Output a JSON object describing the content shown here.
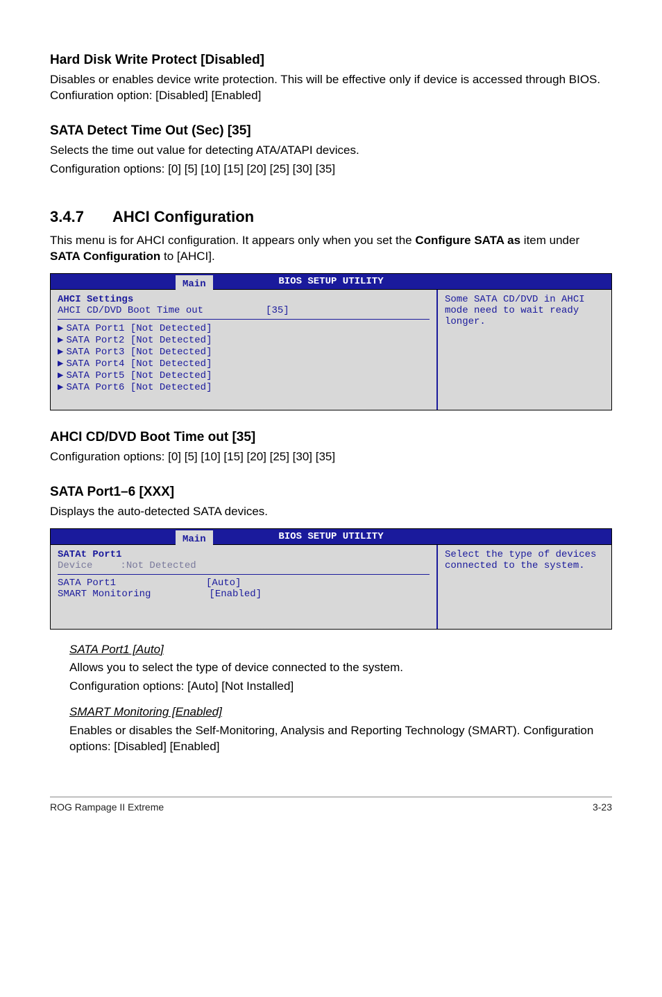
{
  "s1": {
    "title": "Hard Disk Write Protect [Disabled]",
    "p": "Disables or enables device write protection. This will be effective only if device is accessed through BIOS. Confiuration option: [Disabled] [Enabled]"
  },
  "s2": {
    "title": "SATA Detect Time Out (Sec) [35]",
    "p1": "Selects the time out value for detecting ATA/ATAPI devices.",
    "p2": "Configuration options: [0] [5] [10] [15] [20] [25] [30] [35]"
  },
  "sec": {
    "num": "3.4.7",
    "title": "AHCI Configuration"
  },
  "sec_p_a": "This menu is for AHCI configuration. It appears only when you set the ",
  "sec_p_b": "Configure SATA as",
  "sec_p_c": " item under ",
  "sec_p_d": "SATA Configuration",
  "sec_p_e": " to [AHCI].",
  "bios1": {
    "title": "BIOS SETUP UTILITY",
    "tab": "Main",
    "heading": "AHCI Settings",
    "row_label": "AHCI CD/DVD Boot Time out",
    "row_value": "[35]",
    "ports": [
      "SATA Port1 [Not Detected]",
      "SATA Port2 [Not Detected]",
      "SATA Port3 [Not Detected]",
      "SATA Port4 [Not Detected]",
      "SATA Port5 [Not Detected]",
      "SATA Port6 [Not Detected]"
    ],
    "help": "Some SATA CD/DVD in AHCI mode need to wait ready longer."
  },
  "s3": {
    "title": "AHCI CD/DVD Boot Time out [35]",
    "p": "Configuration options: [0] [5] [10] [15] [20] [25] [30] [35]"
  },
  "s4": {
    "title": "SATA Port1–6 [XXX]",
    "p": "Displays the auto-detected SATA devices."
  },
  "bios2": {
    "title": "BIOS SETUP UTILITY",
    "tab": "Main",
    "heading": "SATAt Port1",
    "device_lbl": "Device",
    "device_val": ":Not Detected",
    "r1_lbl": "SATA Port1",
    "r1_val": "[Auto]",
    "r2_lbl": "SMART Monitoring",
    "r2_val": "[Enabled]",
    "help": "Select the type of devices connected to the system."
  },
  "d1": {
    "h": "SATA Port1 [Auto]",
    "p1": "Allows you to select the type of device connected to the system.",
    "p2": "Configuration options: [Auto] [Not Installed]"
  },
  "d2": {
    "h": "SMART Monitoring [Enabled]",
    "p": "Enables or disables the Self-Monitoring, Analysis and Reporting Technology (SMART). Configuration options: [Disabled] [Enabled]"
  },
  "footer": {
    "left": "ROG Rampage II Extreme",
    "right": "3-23"
  }
}
